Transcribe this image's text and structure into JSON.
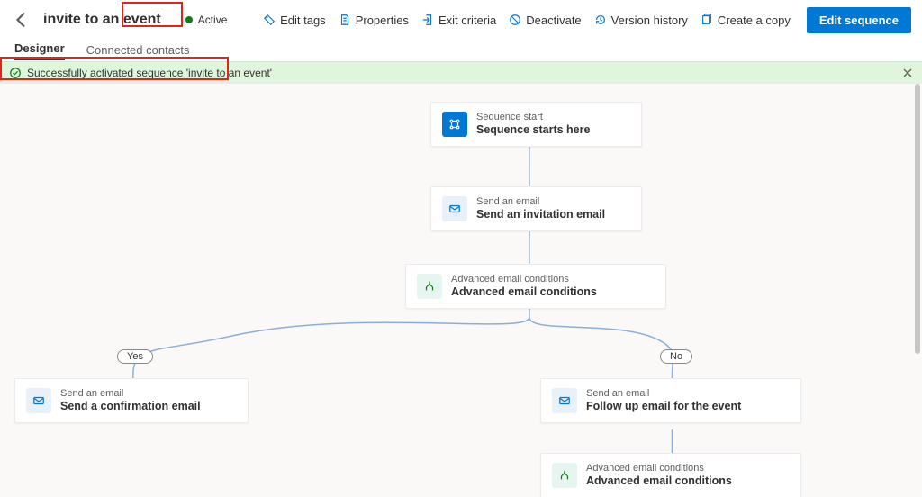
{
  "header": {
    "title": "invite to an event",
    "status_label": "Active"
  },
  "commands": {
    "edit_tags": "Edit tags",
    "properties": "Properties",
    "exit_criteria": "Exit criteria",
    "deactivate": "Deactivate",
    "version_history": "Version history",
    "create_copy": "Create a copy",
    "primary": "Edit sequence"
  },
  "tabs": {
    "designer": "Designer",
    "connected": "Connected contacts"
  },
  "banner": {
    "message": "Successfully activated sequence 'invite to an event'"
  },
  "branches": {
    "yes": "Yes",
    "no": "No"
  },
  "nodes": {
    "start": {
      "sub": "Sequence start",
      "main": "Sequence starts here"
    },
    "email1": {
      "sub": "Send an email",
      "main": "Send an invitation email"
    },
    "cond1": {
      "sub": "Advanced email conditions",
      "main": "Advanced email conditions"
    },
    "emailYes": {
      "sub": "Send an email",
      "main": "Send a confirmation email"
    },
    "emailNo": {
      "sub": "Send an email",
      "main": "Follow up email for the event"
    },
    "cond2": {
      "sub": "Advanced email conditions",
      "main": "Advanced email conditions"
    }
  }
}
